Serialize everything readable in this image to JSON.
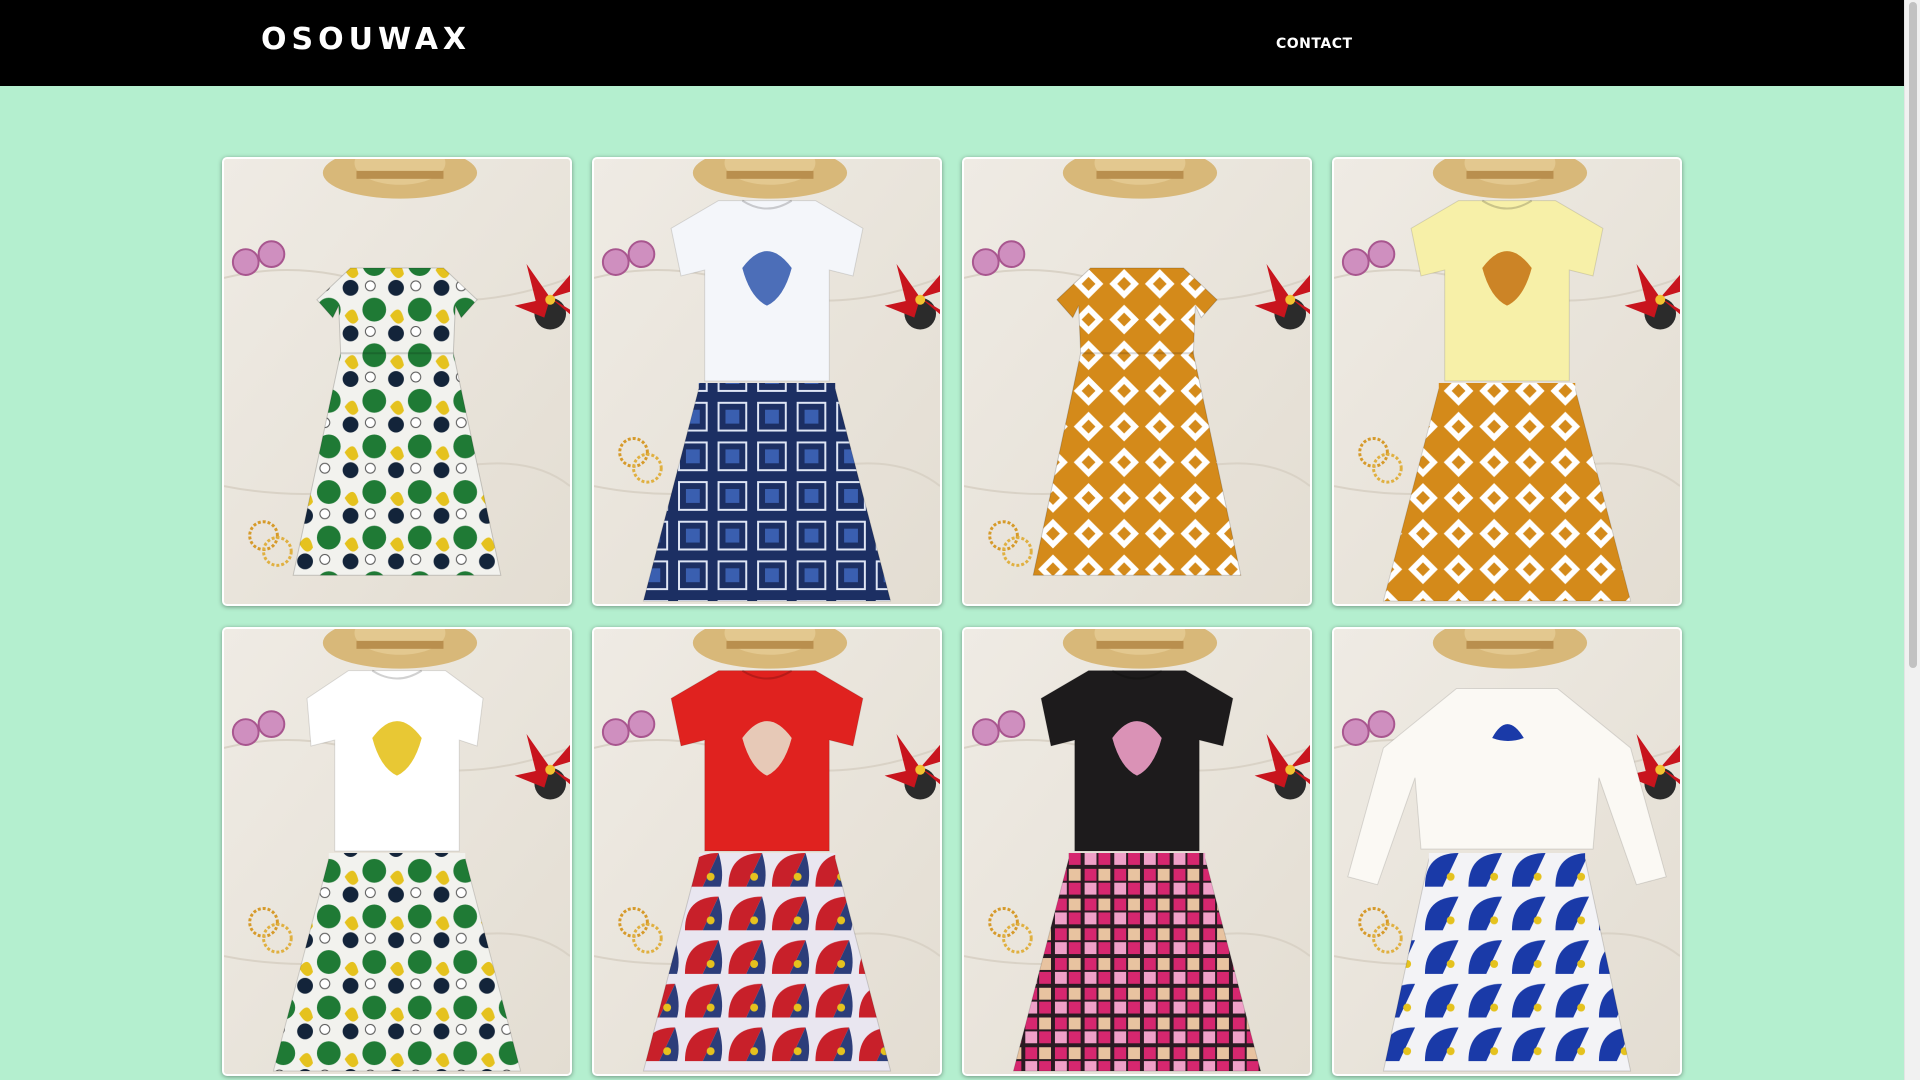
{
  "header": {
    "brand": "OSOUWAX",
    "nav": [
      {
        "label": "CONTACT"
      }
    ]
  },
  "gallery": {
    "items": [
      {
        "top": "dress",
        "top_color": "#2e8b3a",
        "skirt_color": "#1f7a35",
        "accent": "#e5c21e",
        "print": "wax-green"
      },
      {
        "top": "tshirt-ruffle",
        "top_color": "#f4f6fa",
        "skirt_color": "#1c2f63",
        "accent": "#3a5fb0",
        "print": "wax-blue-squares"
      },
      {
        "top": "dress",
        "top_color": "#cf8a1c",
        "skirt_color": "#d48a1a",
        "accent": "#ffffff",
        "print": "wax-orange-diamonds"
      },
      {
        "top": "tshirt-ruffle",
        "top_color": "#f7f0a8",
        "skirt_color": "#d48a1a",
        "accent": "#c77817",
        "print": "wax-orange-diamonds"
      },
      {
        "top": "tshirt",
        "top_color": "#ffffff",
        "skirt_color": "#1f7a35",
        "accent": "#e5c21e",
        "print": "wax-green"
      },
      {
        "top": "tshirt-ruffle",
        "top_color": "#e0221f",
        "skirt_color": "#c8202a",
        "accent": "#e8dcc8",
        "print": "wax-red-fans"
      },
      {
        "top": "tshirt-ruffle",
        "top_color": "#1d1b1c",
        "skirt_color": "#d6276f",
        "accent": "#f0a0c8",
        "print": "wax-pink-plaid"
      },
      {
        "top": "longsleeve",
        "top_color": "#fbf9f4",
        "skirt_color": "#1a3aa8",
        "accent": "#e5c21e",
        "print": "wax-blue-fans"
      }
    ]
  }
}
